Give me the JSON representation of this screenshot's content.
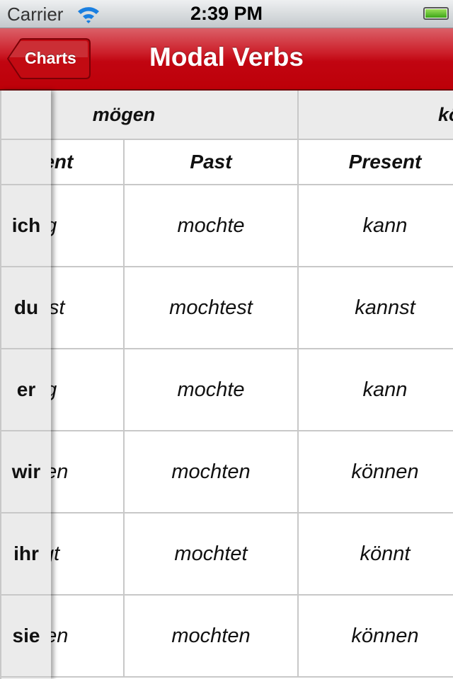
{
  "status": {
    "carrier": "Carrier",
    "time": "2:39 PM",
    "battery_level": 1.0
  },
  "nav": {
    "back_label": "Charts",
    "title": "Modal Verbs",
    "color": "#c10511"
  },
  "table": {
    "verbs": [
      "mögen",
      "können"
    ],
    "subheaders": [
      "Present",
      "Past",
      "Present"
    ],
    "pronouns": [
      "ich",
      "du",
      "er",
      "wir",
      "ihr",
      "sie"
    ],
    "rows": [
      [
        "mag",
        "mochte",
        "kann"
      ],
      [
        "magst",
        "mochtest",
        "kannst"
      ],
      [
        "mag",
        "mochte",
        "kann"
      ],
      [
        "mögen",
        "mochten",
        "können"
      ],
      [
        "mögt",
        "mochtet",
        "könnt"
      ],
      [
        "mögen",
        "mochten",
        "können"
      ]
    ]
  }
}
